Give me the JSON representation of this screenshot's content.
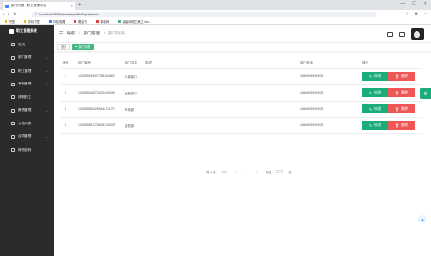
{
  "browser": {
    "tab_title": "部门列表 - 职工管理系统",
    "url": "localhost:9709/department/listDepartment",
    "bookmarks": [
      "书签",
      "手机书签",
      "同站收藏",
      "看证书",
      "新浪网",
      "高级网络之美之Vue..."
    ]
  },
  "sidebar": {
    "brand": "职工管理系统",
    "items": [
      {
        "label": "首页",
        "arrow": false
      },
      {
        "label": "部门管理",
        "arrow": true
      },
      {
        "label": "职工管理",
        "arrow": true
      },
      {
        "label": "考勤管理",
        "arrow": true
      },
      {
        "label": "请假职工",
        "arrow": false
      },
      {
        "label": "薪资管理",
        "arrow": true
      },
      {
        "label": "公告列表",
        "arrow": false
      },
      {
        "label": "合同管理",
        "arrow": true
      },
      {
        "label": "修改密码",
        "arrow": false
      }
    ]
  },
  "header": {
    "breadcrumbs": [
      "导航",
      "部门管理",
      "部门列表"
    ]
  },
  "tags": [
    {
      "label": "首页",
      "active": false
    },
    {
      "label": "部门列表",
      "active": true
    }
  ],
  "table": {
    "headers": [
      "序号",
      "部门编号",
      "部门名称",
      "描述",
      "部门电话",
      "操作"
    ],
    "rows": [
      {
        "index": "1",
        "no": "134059845497768164862",
        "name": "人事部门",
        "desc": "",
        "phone": "18694959X9X00"
      },
      {
        "index": "2",
        "no": "134059846970222043649",
        "name": "运营部门",
        "desc": "",
        "phone": "18694959X9X00"
      },
      {
        "index": "3",
        "no": "134059850025944471170",
        "name": "市场部",
        "desc": "",
        "phone": "18694959X9X00"
      },
      {
        "index": "4",
        "no": "134059851378406124005T",
        "name": "后勤部",
        "desc": "",
        "phone": "18694959X9X00"
      }
    ],
    "edit_label": "修改",
    "delete_label": "删除"
  },
  "pagination": {
    "total": "共 4 条",
    "page_size": "",
    "prev": "‹",
    "current": "1",
    "next": "›",
    "goto_label": "前往",
    "page_suffix": "页"
  },
  "colors": {
    "accent": "#42b983",
    "edit": "#1aad7a",
    "delete": "#f05656",
    "sidebar": "#2b2b2b"
  }
}
